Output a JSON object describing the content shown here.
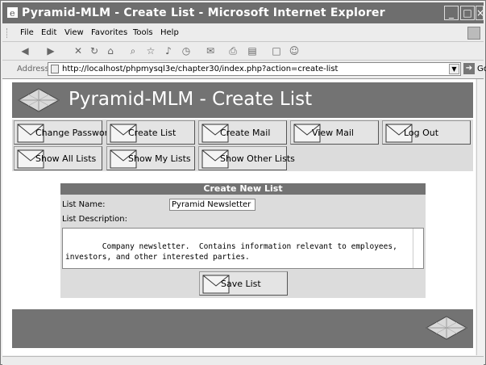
{
  "window": {
    "title": "Pyramid-MLM - Create List - Microsoft Internet Explorer",
    "controls": [
      "_",
      "□",
      "×"
    ]
  },
  "menu": {
    "items": [
      "File",
      "Edit",
      "View",
      "Favorites",
      "Tools",
      "Help"
    ]
  },
  "toolbar": {
    "icons": [
      "back-icon",
      "forward-icon",
      "stop-icon",
      "refresh-icon",
      "home-icon",
      "search-icon",
      "favorites-icon",
      "media-icon",
      "history-icon",
      "mail-icon",
      "print-icon",
      "edit-icon",
      "discuss-icon",
      "messenger-icon"
    ]
  },
  "address": {
    "label": "Address",
    "url": "http://localhost/phpmysql3e/chapter30/index.php?action=create-list",
    "go_label": "Go"
  },
  "page": {
    "header_title": "Pyramid-MLM - Create List",
    "nav": [
      {
        "label": "Change Password"
      },
      {
        "label": "Create List"
      },
      {
        "label": "Create Mail"
      },
      {
        "label": "View Mail"
      },
      {
        "label": "Log Out"
      },
      {
        "label": "Show All Lists"
      },
      {
        "label": "Show My Lists"
      },
      {
        "label": "Show Other Lists"
      }
    ],
    "form": {
      "heading": "Create New List",
      "list_name_label": "List Name:",
      "list_name_value": "Pyramid Newsletter",
      "list_description_label": "List Description:",
      "list_description_value": "Company newsletter.  Contains information relevant to employees,\ninvestors, and other interested parties.",
      "save_label": "Save List"
    }
  },
  "colors": {
    "header_bg": "#737373",
    "nav_bg": "#dcdcdc",
    "panel_bg": "#dcdcdc"
  }
}
